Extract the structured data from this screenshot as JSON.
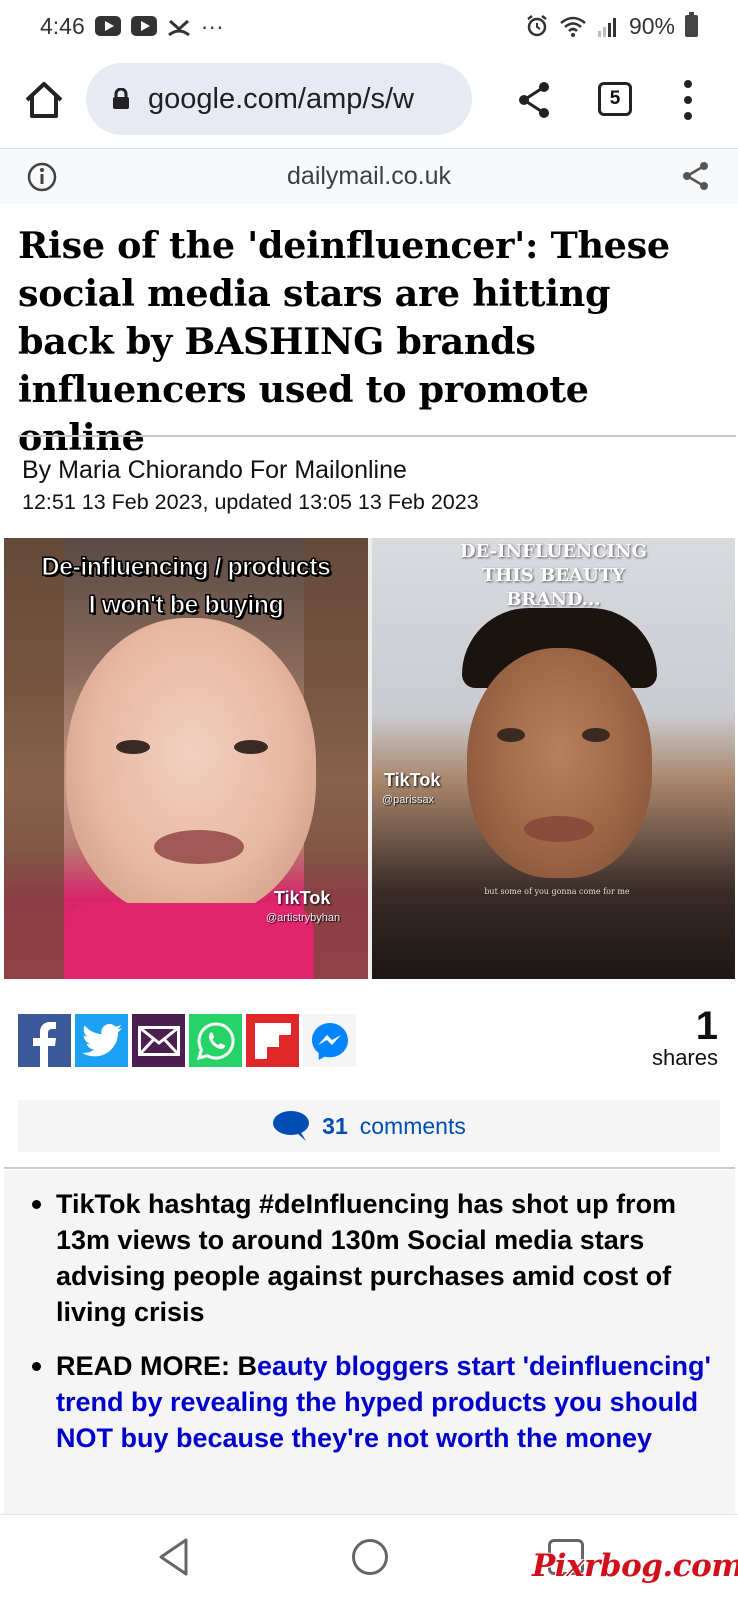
{
  "status_bar": {
    "time": "4:46",
    "dots": "···",
    "battery": "90%"
  },
  "browser": {
    "url": "google.com/amp/s/w",
    "tab_count": "5"
  },
  "amp_header": {
    "domain": "dailymail.co.uk"
  },
  "article": {
    "headline": "Rise of the 'deinfluencer': These social media stars are hitting back by BASHING brands influencers used to promote online",
    "byline": "By Maria Chiorando For Mailonline",
    "timestamp": "12:51 13 Feb 2023, updated 13:05 13 Feb 2023",
    "image": {
      "left_overlay_line1": "De-influencing / products",
      "left_overlay_line2": "I won't be buying",
      "left_tiktok": "TikTok",
      "left_handle": "@artistrybyhan",
      "right_overlay_line1": "DE-INFLUENCING",
      "right_overlay_line2": "THIS BEAUTY",
      "right_overlay_line3": "BRAND...",
      "right_tiktok": "TikTok",
      "right_handle": "@parissax",
      "right_caption": "but some of you gonna come for me"
    },
    "shares_count": "1",
    "shares_label": "shares",
    "comments_count": "31",
    "comments_label": "comments",
    "bullet1": "TikTok hashtag #deInfluencing has shot up from 13m views to around 130m Social media stars advising people against purchases amid cost of living crisis",
    "bullet2_prefix": "READ MORE: B",
    "bullet2_link": "eauty bloggers start 'deinfluencing' trend by revealing the hyped products you should NOT buy because they're not worth the money"
  },
  "share_buttons": [
    "facebook-icon",
    "twitter-icon",
    "email-icon",
    "whatsapp-icon",
    "flipboard-icon",
    "messenger-icon"
  ],
  "colors": {
    "facebook": "#3b5998",
    "twitter": "#1da1f2",
    "email": "#4b1f4f",
    "whatsapp": "#25d366",
    "flipboard": "#e12828",
    "link": "#0000cc",
    "comments": "#004db3"
  },
  "watermark": "Pixrbog.com"
}
